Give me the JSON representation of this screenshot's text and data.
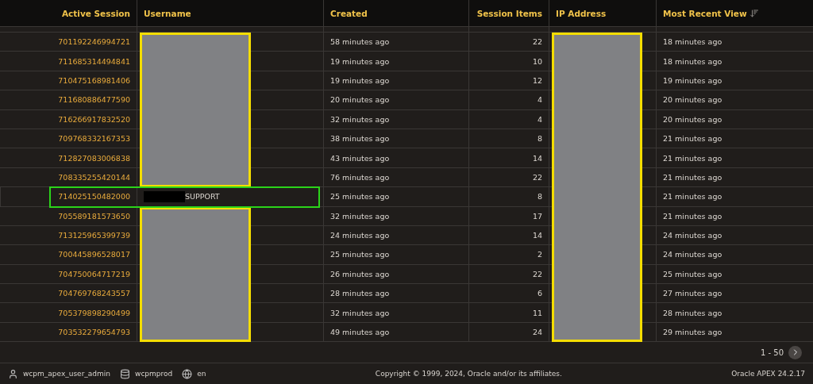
{
  "table": {
    "columns": [
      {
        "label": "Active Session",
        "sorted": false
      },
      {
        "label": "Username",
        "sorted": false
      },
      {
        "label": "Created",
        "sorted": false
      },
      {
        "label": "Session Items",
        "sorted": false
      },
      {
        "label": "IP Address",
        "sorted": false
      },
      {
        "label": "Most Recent View",
        "sorted": true
      }
    ],
    "rows": [
      {
        "session": "701192246994721",
        "username_redacted": true,
        "created": "58 minutes ago",
        "items": "22",
        "ip_redacted": true,
        "recent": "18 minutes ago",
        "highlighted": false
      },
      {
        "session": "711685314494841",
        "username_redacted": true,
        "created": "19 minutes ago",
        "items": "10",
        "ip_redacted": true,
        "recent": "18 minutes ago",
        "highlighted": false
      },
      {
        "session": "710475168981406",
        "username_redacted": true,
        "created": "19 minutes ago",
        "items": "12",
        "ip_redacted": true,
        "recent": "19 minutes ago",
        "highlighted": false
      },
      {
        "session": "711680886477590",
        "username_redacted": true,
        "created": "20 minutes ago",
        "items": "4",
        "ip_redacted": true,
        "recent": "20 minutes ago",
        "highlighted": false
      },
      {
        "session": "716266917832520",
        "username_redacted": true,
        "created": "32 minutes ago",
        "items": "4",
        "ip_redacted": true,
        "recent": "20 minutes ago",
        "highlighted": false
      },
      {
        "session": "709768332167353",
        "username_redacted": true,
        "created": "38 minutes ago",
        "items": "8",
        "ip_redacted": true,
        "recent": "21 minutes ago",
        "highlighted": false
      },
      {
        "session": "712827083006838",
        "username_redacted": true,
        "created": "43 minutes ago",
        "items": "14",
        "ip_redacted": true,
        "recent": "21 minutes ago",
        "highlighted": false
      },
      {
        "session": "708335255420144",
        "username_redacted": true,
        "created": "76 minutes ago",
        "items": "22",
        "ip_redacted": true,
        "recent": "21 minutes ago",
        "highlighted": false
      },
      {
        "session": "714025150482000",
        "username": "SUPPORT",
        "username_redacted": false,
        "username_prefix_blacked": true,
        "created": "25 minutes ago",
        "items": "8",
        "ip_redacted": true,
        "recent": "21 minutes ago",
        "highlighted": true
      },
      {
        "session": "705589181573650",
        "username_redacted": true,
        "created": "32 minutes ago",
        "items": "17",
        "ip_redacted": true,
        "recent": "21 minutes ago",
        "highlighted": false
      },
      {
        "session": "713125965399739",
        "username_redacted": true,
        "created": "24 minutes ago",
        "items": "14",
        "ip_redacted": true,
        "recent": "24 minutes ago",
        "highlighted": false
      },
      {
        "session": "700445896528017",
        "username_redacted": true,
        "created": "25 minutes ago",
        "items": "2",
        "ip_redacted": true,
        "recent": "24 minutes ago",
        "highlighted": false
      },
      {
        "session": "704750064717219",
        "username_redacted": true,
        "created": "26 minutes ago",
        "items": "22",
        "ip_redacted": true,
        "recent": "25 minutes ago",
        "highlighted": false
      },
      {
        "session": "704769768243557",
        "username_redacted": true,
        "created": "28 minutes ago",
        "items": "6",
        "ip_redacted": true,
        "recent": "27 minutes ago",
        "highlighted": false
      },
      {
        "session": "705379898290499",
        "username_redacted": true,
        "created": "32 minutes ago",
        "items": "11",
        "ip_redacted": true,
        "recent": "28 minutes ago",
        "highlighted": false
      },
      {
        "session": "703532279654793",
        "username_redacted": true,
        "created": "49 minutes ago",
        "items": "24",
        "ip_redacted": true,
        "recent": "29 minutes ago",
        "highlighted": false
      }
    ]
  },
  "pagination": {
    "range": "1 - 50"
  },
  "footer": {
    "user": "wcpm_apex_user_admin",
    "schema": "wcpmprod",
    "language": "en",
    "copyright": "Copyright © 1999, 2024, Oracle and/or its affiliates.",
    "version": "Oracle APEX 24.2.17"
  }
}
